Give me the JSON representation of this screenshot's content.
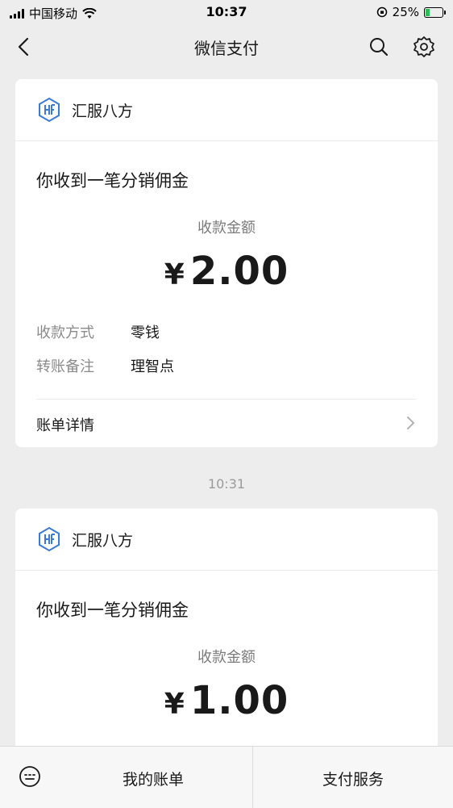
{
  "status_bar": {
    "carrier": "中国移动",
    "time": "10:37",
    "battery": "25%",
    "battery_level": 0.25
  },
  "nav": {
    "title": "微信支付"
  },
  "messages": [
    {
      "brand": "汇服八方",
      "title": "你收到一笔分销佣金",
      "amount_label": "收款金额",
      "currency": "¥",
      "amount": "2.00",
      "details": [
        {
          "label": "收款方式",
          "value": "零钱"
        },
        {
          "label": "转账备注",
          "value": "理智点"
        }
      ],
      "detail_link": "账单详情"
    },
    {
      "brand": "汇服八方",
      "title": "你收到一笔分销佣金",
      "amount_label": "收款金额",
      "currency": "¥",
      "amount": "1.00"
    }
  ],
  "timestamp": "10:31",
  "bottom": {
    "tab1": "我的账单",
    "tab2": "支付服务"
  },
  "colors": {
    "background": "#ededed",
    "brand_icon": "#3a7bd5",
    "battery_fill": "#2ebd59"
  }
}
